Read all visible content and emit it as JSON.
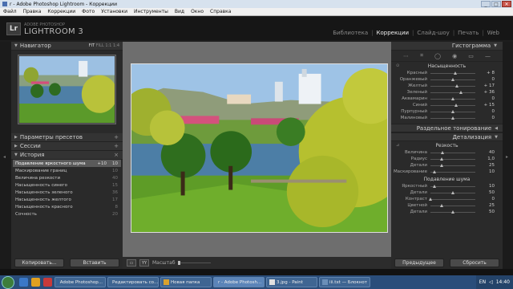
{
  "window": {
    "title": "r - Adobe Photoshop Lightroom - Коррекции",
    "min": "_",
    "max": "□",
    "close": "✕"
  },
  "menu": [
    "Файл",
    "Правка",
    "Коррекции",
    "Фото",
    "Установки",
    "Инструменты",
    "Вид",
    "Окно",
    "Справка"
  ],
  "header": {
    "logo_badge": "Lr",
    "logo_small": "ADOBE PHOTOSHOP",
    "logo_big": "LIGHTROOM 3",
    "modules": [
      "Библиотека",
      "Коррекции",
      "Слайд-шоу",
      "Печать",
      "Web"
    ],
    "active_module": "Коррекции"
  },
  "left": {
    "navigator": {
      "title": "Навигатор",
      "fit": "FIT",
      "fill": "FILL",
      "one": "1:1",
      "ratio": "1:4"
    },
    "presets": {
      "title": "Параметры пресетов",
      "plus": "+"
    },
    "sessions": {
      "title": "Сессии",
      "plus": "+"
    },
    "history": {
      "title": "История",
      "close": "×",
      "items": [
        {
          "label": "Подавление яркостного шума",
          "v1": "+10",
          "v2": "10",
          "selected": true
        },
        {
          "label": "Маскирование границ",
          "v1": "",
          "v2": "10",
          "selected": false
        },
        {
          "label": "Величина резкости",
          "v1": "",
          "v2": "40",
          "selected": false
        },
        {
          "label": "Насыщенность синего",
          "v1": "",
          "v2": "15",
          "selected": false
        },
        {
          "label": "Насыщенность зеленого",
          "v1": "",
          "v2": "36",
          "selected": false
        },
        {
          "label": "Насыщенность желтого",
          "v1": "",
          "v2": "17",
          "selected": false
        },
        {
          "label": "Насыщенность красного",
          "v1": "",
          "v2": "8",
          "selected": false
        },
        {
          "label": "Сочность",
          "v1": "",
          "v2": "20",
          "selected": false
        }
      ]
    },
    "buttons": {
      "copy": "Копировать...",
      "paste": "Вставить"
    }
  },
  "toolbar": {
    "zoom_label": "Масштаб",
    "view1": "▭",
    "view2": "YY"
  },
  "right": {
    "histogram": "Гистограмма",
    "saturation": {
      "title": "Насыщенность",
      "rows": [
        {
          "label": "Красный",
          "value": "+ 8",
          "pos": 0.56
        },
        {
          "label": "Оранжевый",
          "value": "0",
          "pos": 0.5
        },
        {
          "label": "Желтый",
          "value": "+ 17",
          "pos": 0.6
        },
        {
          "label": "Зеленый",
          "value": "+ 36",
          "pos": 0.68
        },
        {
          "label": "Аквамарин",
          "value": "0",
          "pos": 0.5
        },
        {
          "label": "Синий",
          "value": "+ 15",
          "pos": 0.58
        },
        {
          "label": "Пурпурный",
          "value": "0",
          "pos": 0.5
        },
        {
          "label": "Малиновый",
          "value": "0",
          "pos": 0.5
        }
      ]
    },
    "split_toning": "Раздельное тонирование",
    "detail": {
      "title": "Детализация",
      "sharpen": "Резкость",
      "sharpen_rows": [
        {
          "label": "Величина",
          "value": "40",
          "pos": 0.27
        },
        {
          "label": "Радиус",
          "value": "1,0",
          "pos": 0.25
        },
        {
          "label": "Детали",
          "value": "25",
          "pos": 0.25
        },
        {
          "label": "Маскирование",
          "value": "10",
          "pos": 0.1
        }
      ],
      "noise": "Подавление шума",
      "noise_rows": [
        {
          "label": "Яркостный",
          "value": "10",
          "pos": 0.1
        },
        {
          "label": "Детали",
          "value": "50",
          "pos": 0.5
        },
        {
          "label": "Контраст",
          "value": "0",
          "pos": 0.0
        },
        {
          "label": "Цветной",
          "value": "25",
          "pos": 0.25
        },
        {
          "label": "Детали",
          "value": "50",
          "pos": 0.5
        }
      ]
    },
    "buttons": {
      "previous": "Предыдущее",
      "reset": "Сбросить"
    }
  },
  "taskbar": {
    "tasks": [
      {
        "label": "Adobe Photoshop...",
        "active": false
      },
      {
        "label": "Редактировать со...",
        "active": false
      },
      {
        "label": "Новая папка",
        "active": false
      },
      {
        "label": "r - Adobe Photosh...",
        "active": true
      },
      {
        "label": "3.jpg - Paint",
        "active": false
      },
      {
        "label": "iii.txt — Блокнот",
        "active": false
      }
    ],
    "lang": "EN",
    "clock": "14:40"
  }
}
